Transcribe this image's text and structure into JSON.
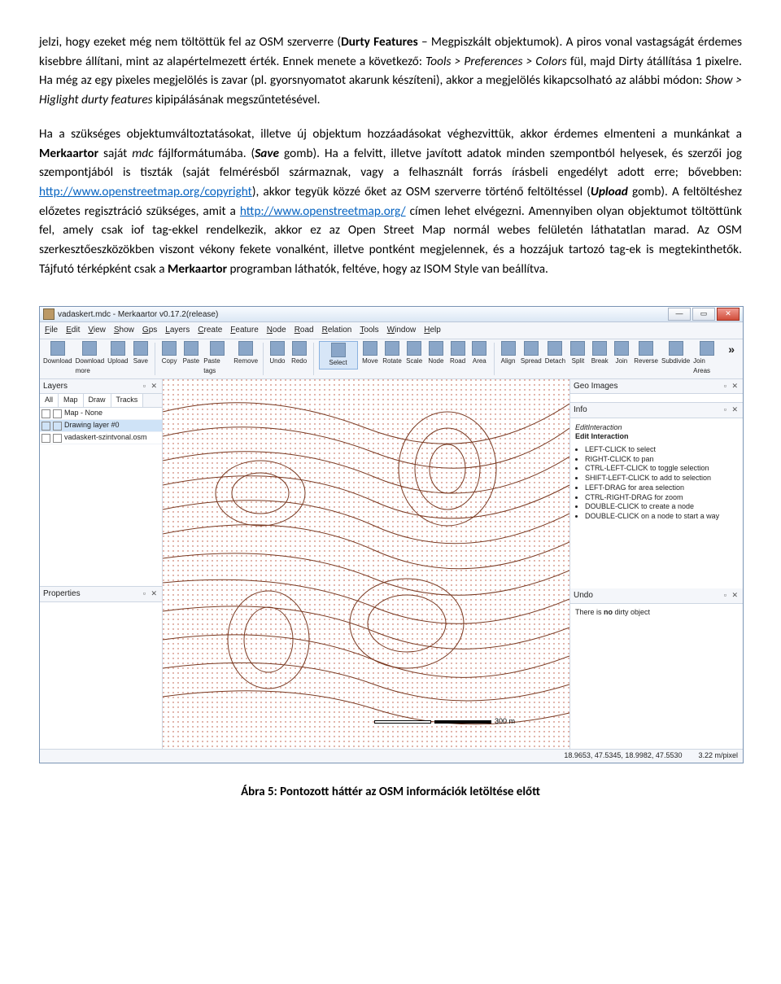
{
  "para1": {
    "t1": "jelzi, hogy ezeket még nem töltöttük fel az OSM szerverre (",
    "durty": "Durty Features",
    "t2": " – Megpiszkált objektumok). A piros vonal vastagságát érdemes kisebbre állítani, mint az alapértelmezett érték. Ennek menete a következő: ",
    "path1": "Tools > Preferences > Colors",
    "t3": " fül, majd Dirty átállítása 1 pixelre. Ha még az egy pixeles megjelölés is zavar (pl. gyorsnyomatot akarunk készíteni), akkor a megjelölés kikapcsolható az alábbi módon: ",
    "path2": "Show > Higlight durty features",
    "t4": " kipipálásának megszűntetésével."
  },
  "para2": {
    "t1": "Ha a szükséges objektumváltoztatásokat, illetve új objektum hozzáadásokat véghezvittük, akkor érdemes elmenteni a munkánkat a ",
    "merk": "Merkaartor",
    "t2": " saját ",
    "mdc": "mdc",
    "t3": " fájlformátumába. (",
    "save": "Save",
    "t4": " gomb). Ha a felvitt, illetve javított adatok minden szempontból helyesek, és szerzői jog szempontjából is tiszták (saját felmérésből származnak, vagy a felhasznált forrás írásbeli engedélyt adott erre; bővebben: ",
    "link1": "http://www.openstreetmap.org/copyright",
    "t5": "), akkor tegyük közzé őket az OSM szerverre történő feltöltéssel (",
    "upload": "Upload",
    "t6": " gomb). A feltöltéshez előzetes regisztráció szükséges, amit a ",
    "link2": "http://www.openstreetmap.org/",
    "t7": " címen lehet elvégezni. Amennyiben olyan objektumot töltöttünk fel, amely csak iof tag-ekkel rendelkezik, akkor ez az Open Street Map normál webes felületén láthatatlan marad. Az OSM szerkesztőeszközökben viszont vékony fekete vonalként, illetve pontként megjelennek, és a hozzájuk tartozó tag-ek is megtekinthetők. Tájfutó térképként csak a ",
    "merk2": "Merkaartor",
    "t8": " programban láthatók, feltéve, hogy az ISOM Style van beállítva."
  },
  "app": {
    "title": "vadaskert.mdc - Merkaartor v0.17.2(release)",
    "menu": [
      "File",
      "Edit",
      "View",
      "Show",
      "Gps",
      "Layers",
      "Create",
      "Feature",
      "Node",
      "Road",
      "Relation",
      "Tools",
      "Window",
      "Help"
    ],
    "toolbar": [
      "Download",
      "Download more",
      "Upload",
      "Save",
      "Copy",
      "Paste",
      "Paste tags",
      "Remove",
      "Undo",
      "Redo",
      "Select",
      "Move",
      "Rotate",
      "Scale",
      "Node",
      "Road",
      "Area",
      "Align",
      "Spread",
      "Detach",
      "Split",
      "Break",
      "Join",
      "Reverse",
      "Subdivide",
      "Join Areas"
    ],
    "toolbar_active_index": 10,
    "overflow": "»",
    "layers_panel": "Layers",
    "layers_tabs": [
      "All",
      "Map",
      "Draw",
      "Tracks"
    ],
    "layers": [
      {
        "label": "Map - None",
        "sel": false
      },
      {
        "label": "Drawing layer #0",
        "sel": true
      },
      {
        "label": "vadaskert-szintvonal.osm",
        "sel": false
      }
    ],
    "props_panel": "Properties",
    "geo_panel": "Geo Images",
    "info_panel": "Info",
    "info_head1": "EditInteraction",
    "info_head2": "Edit Interaction",
    "info_items": [
      "LEFT-CLICK to select",
      "RIGHT-CLICK to pan",
      "CTRL-LEFT-CLICK to toggle selection",
      "SHIFT-LEFT-CLICK to add to selection",
      "LEFT-DRAG for area selection",
      "CTRL-RIGHT-DRAG for zoom",
      "DOUBLE-CLICK to create a node",
      "DOUBLE-CLICK on a node to start a way"
    ],
    "undo_panel": "Undo",
    "undo_text_a": "There is ",
    "undo_text_b": "no",
    "undo_text_c": " dirty object",
    "scale_label": "300 m",
    "status_coords": "18.9653, 47.5345, 18.9982, 47.5530",
    "status_zoom": "3.22 m/pixel"
  },
  "caption": "Ábra 5: Pontozott háttér az OSM információk letöltése előtt"
}
